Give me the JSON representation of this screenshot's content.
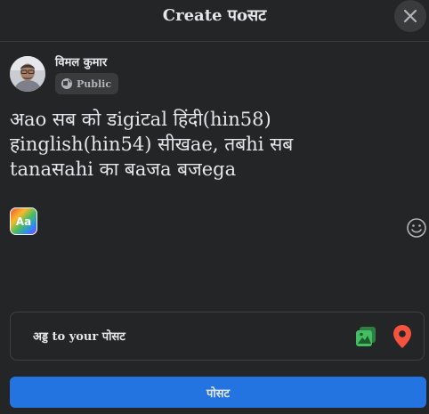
{
  "header": {
    "title": "Create पoसट"
  },
  "user": {
    "name": "विमल कुमार",
    "privacy_label": "Public"
  },
  "composer": {
    "text": "अao सब को डigiटal हिंदी(hin58)\nहinglish(hin54) सीखae, तबhi सब\ntanaसahi का बaजa बजega"
  },
  "add_to_post": {
    "label": "अड्ड to your पोसट"
  },
  "footer": {
    "post_label": "पोसट"
  },
  "icons": {
    "close": "close-icon",
    "privacy": "globe-icon",
    "background": "text-background-icon",
    "emoji": "emoji-icon",
    "photo": "photo-video-icon",
    "location": "location-pin-icon"
  },
  "colors": {
    "background": "#242526",
    "accent": "#2374e1",
    "photo_green": "#45bd62",
    "location_red": "#f5533d"
  }
}
